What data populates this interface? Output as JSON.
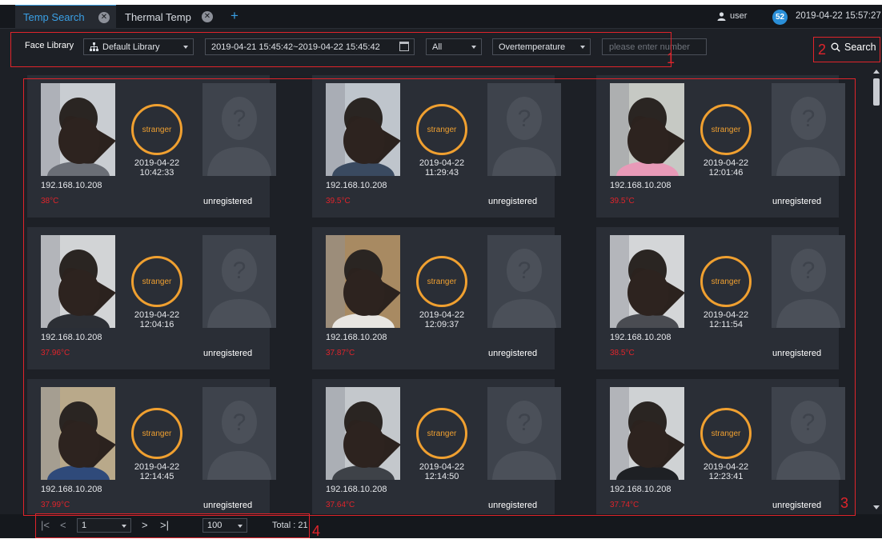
{
  "tabs": [
    {
      "label": "Temp Search",
      "close_glyph": "✕",
      "active": true
    },
    {
      "label": "Thermal Temp",
      "close_glyph": "✕",
      "active": false
    }
  ],
  "add_tab_glyph": "+",
  "header": {
    "user_label": "user",
    "notification_count": "52",
    "datetime": "2019-04-22 15:57:27"
  },
  "filters": {
    "face_library_label": "Face Library",
    "library_value": "Default Library",
    "date_range": "2019-04-21 15:45:42~2019-04-22 15:45:42",
    "channel_value": "All",
    "type_value": "Overtemperature",
    "number_placeholder": "please enter number",
    "search_label": "Search"
  },
  "callouts": {
    "one": "1",
    "two": "2",
    "three": "3",
    "four": "4"
  },
  "results": [
    {
      "status": "stranger",
      "date": "2019-04-22",
      "time": "10:42:33",
      "ip": "192.168.10.208",
      "temp": "38°C",
      "registration": "unregistered",
      "shirt": "#6a6e76",
      "bg": "#c9cdd2"
    },
    {
      "status": "stranger",
      "date": "2019-04-22",
      "time": "11:29:43",
      "ip": "192.168.10.208",
      "temp": "39.5°C",
      "registration": "unregistered",
      "shirt": "#3a4a60",
      "bg": "#bfc5cc"
    },
    {
      "status": "stranger",
      "date": "2019-04-22",
      "time": "12:01:46",
      "ip": "192.168.10.208",
      "temp": "39.5°C",
      "registration": "unregistered",
      "shirt": "#e89ab8",
      "bg": "#c6c9c4"
    },
    {
      "status": "stranger",
      "date": "2019-04-22",
      "time": "12:04:16",
      "ip": "192.168.10.208",
      "temp": "37.96°C",
      "registration": "unregistered",
      "shirt": "#2c2f35",
      "bg": "#d2d4d6"
    },
    {
      "status": "stranger",
      "date": "2019-04-22",
      "time": "12:09:37",
      "ip": "192.168.10.208",
      "temp": "37.87°C",
      "registration": "unregistered",
      "shirt": "#e8e6e2",
      "bg": "#a88a62"
    },
    {
      "status": "stranger",
      "date": "2019-04-22",
      "time": "12:11:54",
      "ip": "192.168.10.208",
      "temp": "38.5°C",
      "registration": "unregistered",
      "shirt": "#4a4c52",
      "bg": "#d4d6d8"
    },
    {
      "status": "stranger",
      "date": "2019-04-22",
      "time": "12:14:45",
      "ip": "192.168.10.208",
      "temp": "37.99°C",
      "registration": "unregistered",
      "shirt": "#2f4a7a",
      "bg": "#b9a98a"
    },
    {
      "status": "stranger",
      "date": "2019-04-22",
      "time": "12:14:50",
      "ip": "192.168.10.208",
      "temp": "37.64°C",
      "registration": "unregistered",
      "shirt": "#3e4248",
      "bg": "#c4c8cc"
    },
    {
      "status": "stranger",
      "date": "2019-04-22",
      "time": "12:23:41",
      "ip": "192.168.10.208",
      "temp": "37.74°C",
      "registration": "unregistered",
      "shirt": "#1e2024",
      "bg": "#cfd2d4"
    }
  ],
  "pagination": {
    "first_glyph": "|<",
    "prev_glyph": "<",
    "next_glyph": ">",
    "last_glyph": ">|",
    "page_value": "1",
    "page_size": "100",
    "total_text": "Total : 21"
  },
  "icons": {
    "tab_close": "close-icon",
    "user": "user-icon",
    "library": "org-tree-icon",
    "calendar": "calendar-icon",
    "search": "search-icon",
    "unknown_person": "person-silhouette-icon"
  },
  "colors": {
    "accent": "#3aa0e6",
    "stranger_ring": "#f0a030",
    "temperature": "#e0242b",
    "callout": "#e0242b",
    "badge": "#2a8fd8"
  }
}
